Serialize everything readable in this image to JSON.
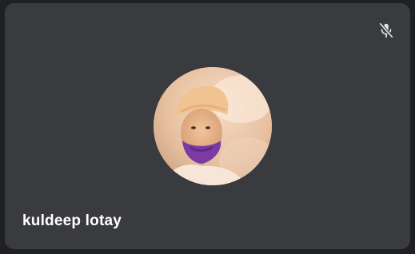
{
  "participant": {
    "name": "kuldeep lotay",
    "mic_status_icon": "microphone-off-icon"
  },
  "colors": {
    "tile_background": "#3a3b3e",
    "page_background": "#1f2022",
    "name_text": "#ffffff",
    "icon": "#e6e6e6"
  }
}
